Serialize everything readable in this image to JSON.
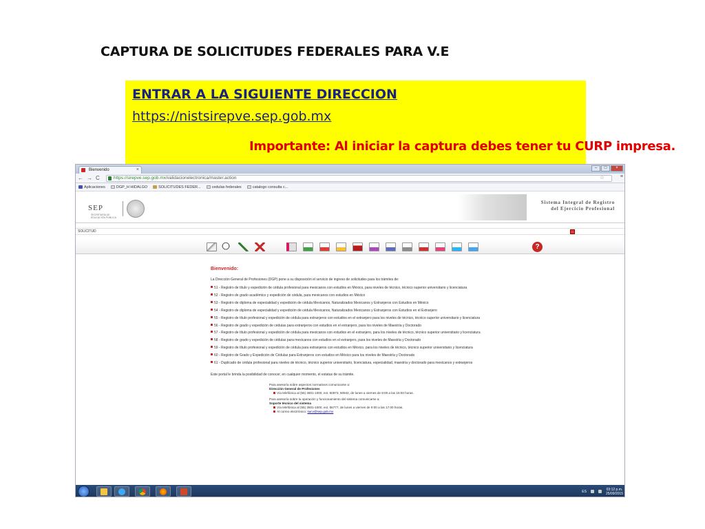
{
  "slide": {
    "title": "CAPTURA DE SOLICITUDES FEDERALES PARA V.E",
    "box_heading": "ENTRAR A LA SIGUIENTE DIRECCION",
    "box_url": "https://nistsirepve.sep.gob.mx",
    "important": "Importante: Al iniciar la captura debes tener tu CURP impresa."
  },
  "browser": {
    "tab_title": "Bienvenido",
    "tab_close": "×",
    "win_min": "–",
    "win_max": "□",
    "win_close": "×",
    "back": "←",
    "forward": "→",
    "reload": "C",
    "url_host": "https://sirepve.sep.gob.mx",
    "url_path": "/validacionelectronica/master.action",
    "bookmarks": [
      "Aplicaciones",
      "DGP_H HIDALGO",
      "SOLICITUDES FEDER...",
      "cedulas federales",
      "catalogo consulta c..."
    ]
  },
  "sep": {
    "logo": "SEP",
    "logo_sub": "SECRETARÍA DE EDUCACIÓN PÚBLICA",
    "system_line1": "Sistema Integral de Registro",
    "system_line2": "del Ejercicio Profesional"
  },
  "solicitud_label": "SOLICITUD",
  "help_label": "?",
  "content": {
    "welcome": "Bienvenido:",
    "intro": "La Dirección General de Profesiones (DGP) pone a su disposición el servicio de ingreso de solicitudes para los trámites de:",
    "tramites": [
      "51 - Registro de título y expedición de cédula profesional para mexicanos con estudios en México, para niveles de técnico, técnico superior universitario y licenciatura",
      "52 - Registro de grado académico y expedición de cédula, para mexicanos con estudios en México",
      "53 - Registro de diploma de especialidad y expedición de cédula Mexicanos, Naturalizados Mexicanos y Extranjeros con Estudios en México",
      "54 - Registro de diploma de especialidad y expedición de cédula Mexicanos, Naturalizados Mexicanos y Extranjeros con Estudios en el Extranjero",
      "55 - Registro de título profesional y expedición de cédula para extranjeros con estudios en el extranjero para los niveles de técnico, técnico superior universitario y licenciatura",
      "56 - Registro de grado y expedición de cédulas para extranjeros con estudios en el extranjero, para los niveles de Maestría y Doctorado",
      "57 - Registro de título profesional y expedición de cédula para mexicanos con estudios en el extranjero, para los niveles de técnico, técnico superior universitario y licenciatura",
      "58 - Registro de grado y expedición de cédulas para mexicanos con estudios en el extranjero, para los niveles de Maestría y Doctorado",
      "59 - Registro de título profesional y expedición de cédula para extranjeros con estudios en México, para los niveles de técnico, técnico superior universitario y licenciatura",
      "60 - Registro de Grado y Expedición de Cédulas para Extranjeros con estudios en México para los niveles de Maestría y Doctorado",
      "61 - Duplicado de cédula profesional para niveles de técnico, técnico superior universitario, licenciatura, especialidad, maestría y doctorado para mexicanos y extranjeros"
    ],
    "portal": "Este portal le brinda la posibilidad de conocer, en cualquier momento, el estatus de su trámite.",
    "asesoria1": "Para asesoría sobre aspectos normativos comunicarse a:",
    "dgp_name": "Dirección General de Profesiones",
    "dgp_phone": "Vía telefónica al (55) 3601-1000, ext. 60973, 60942, de lunes a viernes de 9:00 a las 15:00 horas.",
    "asesoria2": "Para asesoría sobre la operación y funcionamiento del sistema comunicarse a:",
    "soporte": "Soporte técnico del sistema",
    "soporte_phone": "Vía telefónica al (55) 3601-1000, ext. 55777, de lunes a viernes de 9:00 a las 17:00 horas.",
    "soporte_mail_label": "Al correo electrónico:",
    "soporte_mail": "sacv@sep.gob.mx"
  },
  "taskbar": {
    "lang": "ES",
    "time": "03:12 p.m.",
    "date": "25/09/2015"
  }
}
